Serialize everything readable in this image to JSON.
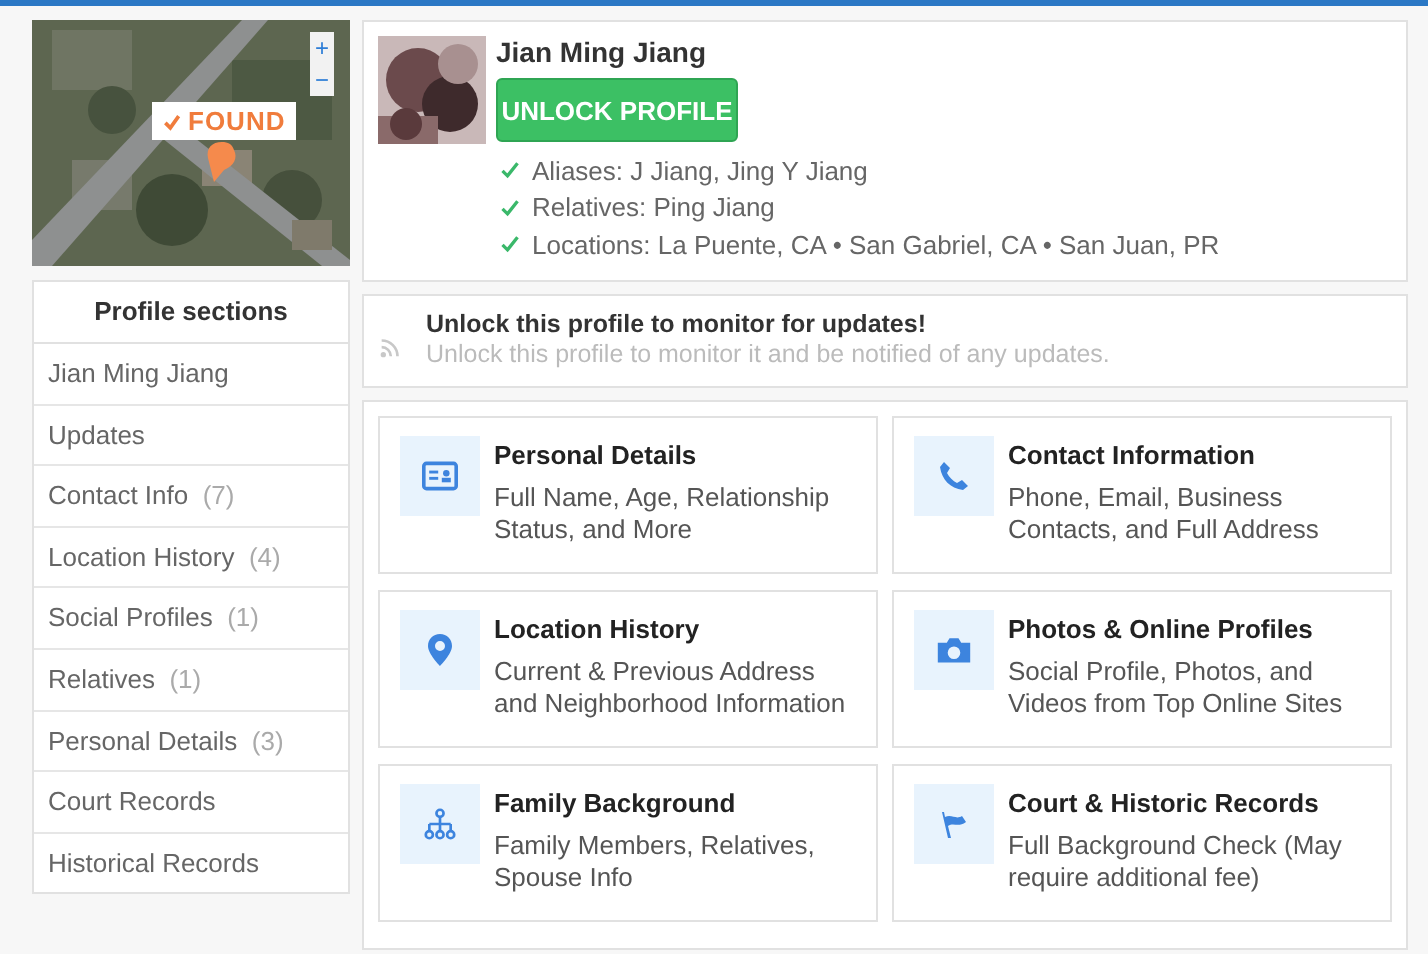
{
  "map": {
    "badge": "FOUND",
    "zoom_in": "+",
    "zoom_out": "−"
  },
  "sidebar": {
    "title": "Profile sections",
    "items": [
      {
        "label": "Jian Ming Jiang"
      },
      {
        "label": "Updates"
      },
      {
        "label": "Contact Info",
        "count": "(7)"
      },
      {
        "label": "Location History",
        "count": "(4)"
      },
      {
        "label": "Social Profiles",
        "count": "(1)"
      },
      {
        "label": "Relatives",
        "count": "(1)"
      },
      {
        "label": "Personal Details",
        "count": "(3)"
      },
      {
        "label": "Court Records"
      },
      {
        "label": "Historical Records"
      }
    ]
  },
  "profile": {
    "name": "Jian Ming Jiang",
    "button": "UNLOCK PROFILE",
    "facts": [
      "Aliases: J Jiang, Jing Y Jiang",
      "Relatives: Ping Jiang",
      "Locations: La Puente, CA • San Gabriel, CA • San Juan, PR"
    ]
  },
  "notice": {
    "title": "Unlock this profile to monitor for updates!",
    "text": "Unlock this profile to monitor it and be notified of any updates."
  },
  "sections": [
    {
      "kind": "id-card",
      "title": "Personal Details",
      "description": "Full Name, Age, Relationship Status, and More"
    },
    {
      "kind": "phone",
      "title": "Contact Information",
      "description": "Phone, Email, Business Contacts, and Full Address"
    },
    {
      "kind": "location",
      "title": "Location History",
      "description": "Current & Previous Address and Neighborhood Information"
    },
    {
      "kind": "camera",
      "title": "Photos & Online Profiles",
      "description": "Social Profile, Photos, and Videos from Top Online Sites"
    },
    {
      "kind": "tree",
      "title": "Family Background",
      "description": "Family Members, Relatives, Spouse Info"
    },
    {
      "kind": "flag",
      "title": "Court & Historic Records",
      "description": "Full Background Check (May require additional fee)"
    }
  ]
}
